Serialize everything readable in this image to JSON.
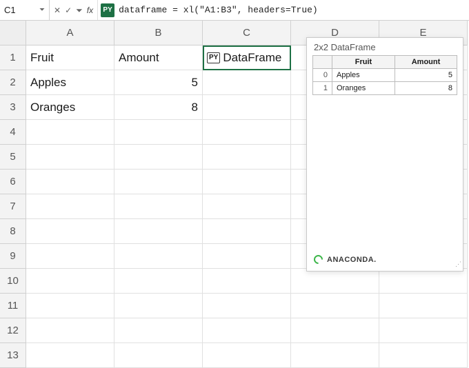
{
  "formula_bar": {
    "active_cell": "C1",
    "cancel_symbol": "✕",
    "confirm_symbol": "✓",
    "dropdown_symbol": "⏷",
    "fx_label": "fx",
    "py_badge": "PY",
    "formula": "dataframe = xl(\"A1:B3\", headers=True)"
  },
  "columns": [
    "A",
    "B",
    "C",
    "D",
    "E"
  ],
  "rows": [
    "1",
    "2",
    "3",
    "4",
    "5",
    "6",
    "7",
    "8",
    "9",
    "10",
    "11",
    "12",
    "13"
  ],
  "cells": {
    "A1": "Fruit",
    "B1": "Amount",
    "C1_badge": "PY",
    "C1": "DataFrame",
    "A2": "Apples",
    "B2": "5",
    "A3": "Oranges",
    "B3": "8"
  },
  "popover": {
    "title": "2x2 DataFrame",
    "columns": [
      "Fruit",
      "Amount"
    ],
    "rows": [
      {
        "idx": "0",
        "fruit": "Apples",
        "amount": "5"
      },
      {
        "idx": "1",
        "fruit": "Oranges",
        "amount": "8"
      }
    ],
    "footer_brand": "ANACONDA."
  }
}
